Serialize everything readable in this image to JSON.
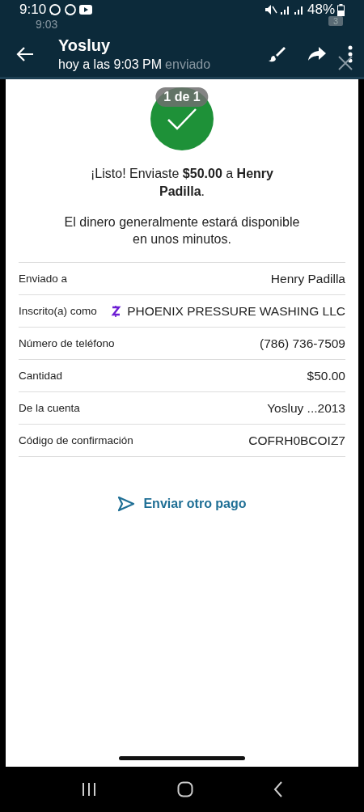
{
  "status_bar": {
    "time": "9:10",
    "ghost_time": "9:03",
    "battery": "48%",
    "ghost_badge": "3"
  },
  "header": {
    "title": "Yosluy",
    "subtitle": "hoy a las 9:03 PM",
    "ghost_subtitle": "enviado"
  },
  "viewer": {
    "counter": "1 de 1"
  },
  "receipt": {
    "headline": "¡Listo! Enviaste **$50.00** a **Henry Padilla**.",
    "note": "El dinero generalmente estará disponible en unos minutos.",
    "rows": [
      {
        "kind": "plain",
        "label": "Enviado a",
        "value": "Henry Padilla"
      },
      {
        "kind": "zelle",
        "label": "Inscrito(a) como",
        "value": "PHOENIX PRESSURE WASHING LLC"
      },
      {
        "kind": "plain",
        "label": "Número de teléfono",
        "value": "(786) 736-7509"
      },
      {
        "kind": "plain",
        "label": "Cantidad",
        "value": "$50.00"
      },
      {
        "kind": "plain",
        "label": "De la cuenta",
        "value": "Yosluy ...2013"
      },
      {
        "kind": "plain",
        "label": "Código de confirmación",
        "value": "COFRH0BCOIZ7"
      }
    ],
    "action": "Enviar otro pago"
  }
}
